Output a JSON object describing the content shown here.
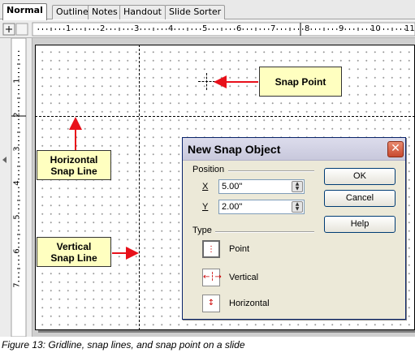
{
  "tabs": [
    {
      "label": "Normal",
      "active": true
    },
    {
      "label": "Outline",
      "active": false
    },
    {
      "label": "Notes",
      "active": false
    },
    {
      "label": "Handout",
      "active": false
    },
    {
      "label": "Slide Sorter",
      "active": false
    }
  ],
  "ruler": {
    "h_numbers": [
      "1",
      "2",
      "3",
      "4",
      "5",
      "6",
      "7",
      "8",
      "9",
      "10",
      "11"
    ],
    "v_numbers": [
      "1",
      "2",
      "3",
      "4",
      "5",
      "6",
      "7"
    ]
  },
  "callouts": {
    "snap_point": "Snap Point",
    "horizontal": "Horizontal Snap Line",
    "vertical": "Vertical Snap Line"
  },
  "dialog": {
    "title": "New Snap Object",
    "close_glyph": "✕",
    "position_label": "Position",
    "x_label": "X",
    "x_value": "5.00\"",
    "y_label": "Y",
    "y_value": "2.00\"",
    "type_label": "Type",
    "type_options": [
      {
        "label": "Point",
        "icon": "point-icon",
        "selected": true
      },
      {
        "label": "Vertical",
        "icon": "vertical-icon",
        "selected": false
      },
      {
        "label": "Horizontal",
        "icon": "horizontal-icon",
        "selected": false
      }
    ],
    "ok": "OK",
    "cancel": "Cancel",
    "help": "Help"
  },
  "caption": "Figure 13: Gridline, snap lines, and snap point on a slide",
  "colors": {
    "arrow": "#e8101a",
    "callout_bg": "#ffffc0"
  }
}
